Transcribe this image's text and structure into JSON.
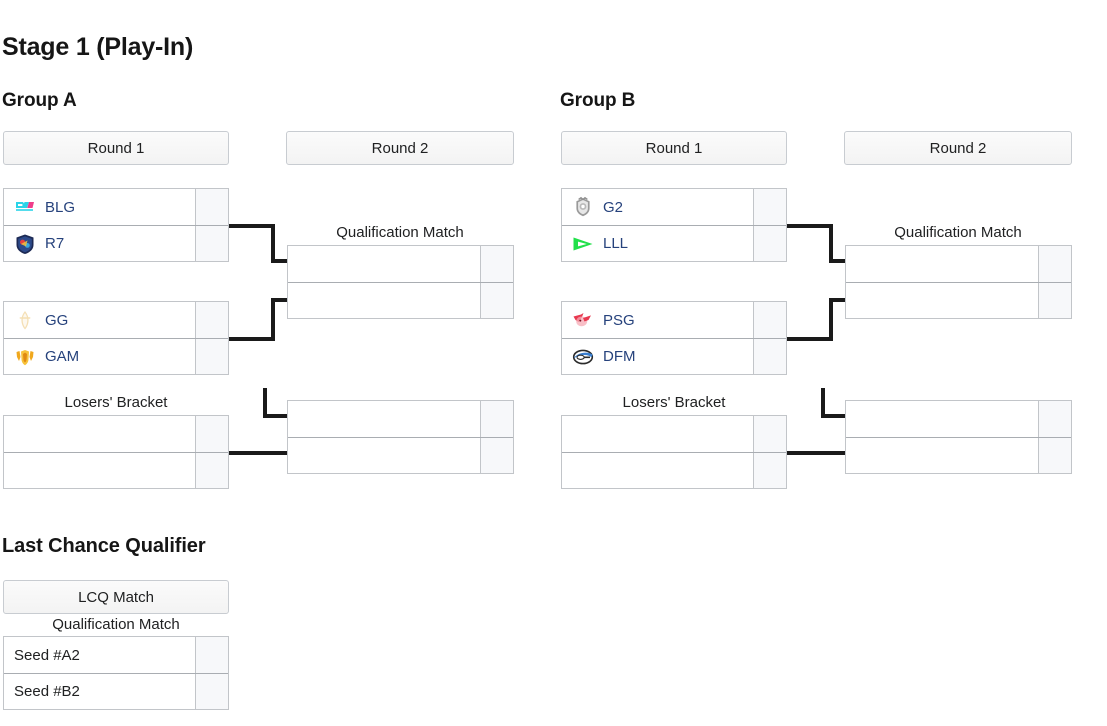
{
  "stage": {
    "title": "Stage 1 (Play-In)"
  },
  "groups": [
    {
      "title": "Group A",
      "round1_label": "Round 1",
      "round2_label": "Round 2",
      "qualification_label": "Qualification Match",
      "losers_label": "Losers' Bracket",
      "upper_match": {
        "teams": [
          {
            "name": "BLG",
            "logo": "blg-logo",
            "score": ""
          },
          {
            "name": "R7",
            "logo": "r7-logo",
            "score": ""
          }
        ]
      },
      "lower_match": {
        "teams": [
          {
            "name": "GG",
            "logo": "gg-logo",
            "score": ""
          },
          {
            "name": "GAM",
            "logo": "gam-logo",
            "score": ""
          }
        ]
      },
      "qualification_match": {
        "teams": [
          {
            "name": "",
            "logo": "",
            "score": ""
          },
          {
            "name": "",
            "logo": "",
            "score": ""
          }
        ]
      },
      "losers_match": {
        "teams": [
          {
            "name": "",
            "logo": "",
            "score": ""
          },
          {
            "name": "",
            "logo": "",
            "score": ""
          }
        ]
      },
      "losers_round2_match": {
        "teams": [
          {
            "name": "",
            "logo": "",
            "score": ""
          },
          {
            "name": "",
            "logo": "",
            "score": ""
          }
        ]
      }
    },
    {
      "title": "Group B",
      "round1_label": "Round 1",
      "round2_label": "Round 2",
      "qualification_label": "Qualification Match",
      "losers_label": "Losers' Bracket",
      "upper_match": {
        "teams": [
          {
            "name": "G2",
            "logo": "g2-logo",
            "score": ""
          },
          {
            "name": "LLL",
            "logo": "lll-logo",
            "score": ""
          }
        ]
      },
      "lower_match": {
        "teams": [
          {
            "name": "PSG",
            "logo": "psg-logo",
            "score": ""
          },
          {
            "name": "DFM",
            "logo": "dfm-logo",
            "score": ""
          }
        ]
      },
      "qualification_match": {
        "teams": [
          {
            "name": "",
            "logo": "",
            "score": ""
          },
          {
            "name": "",
            "logo": "",
            "score": ""
          }
        ]
      },
      "losers_match": {
        "teams": [
          {
            "name": "",
            "logo": "",
            "score": ""
          },
          {
            "name": "",
            "logo": "",
            "score": ""
          }
        ]
      },
      "losers_round2_match": {
        "teams": [
          {
            "name": "",
            "logo": "",
            "score": ""
          },
          {
            "name": "",
            "logo": "",
            "score": ""
          }
        ]
      }
    }
  ],
  "lcq": {
    "title": "Last Chance Qualifier",
    "match_header": "LCQ Match",
    "caption": "Qualification Match",
    "teams": [
      {
        "name": "Seed #A2",
        "score": ""
      },
      {
        "name": "Seed #B2",
        "score": ""
      }
    ]
  },
  "colors": {
    "link": "#26427c",
    "header_bg": "#f3f3f3",
    "border": "#c2c5c9",
    "line": "#1a1a1a",
    "score_bg": "#f7f8fa"
  }
}
